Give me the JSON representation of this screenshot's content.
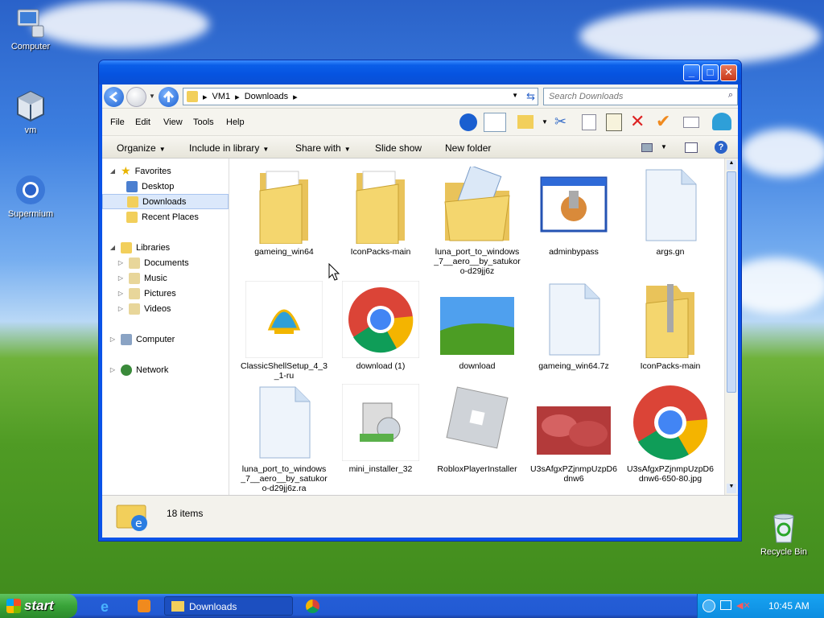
{
  "desktop": {
    "icons": [
      {
        "label": "Computer"
      },
      {
        "label": "vm"
      },
      {
        "label": "Supermium"
      },
      {
        "label": "Recycle Bin"
      }
    ]
  },
  "window": {
    "address": {
      "crumbs": [
        "VM1",
        "Downloads"
      ]
    },
    "search_placeholder": "Search Downloads",
    "menu": [
      "File",
      "Edit",
      "View",
      "Tools",
      "Help"
    ],
    "commands": {
      "organize": "Organize",
      "include": "Include in library",
      "share": "Share with",
      "slideshow": "Slide show",
      "newfolder": "New folder"
    },
    "nav": {
      "favorites": "Favorites",
      "desktop": "Desktop",
      "downloads": "Downloads",
      "recent": "Recent Places",
      "libraries": "Libraries",
      "documents": "Documents",
      "music": "Music",
      "pictures": "Pictures",
      "videos": "Videos",
      "computer": "Computer",
      "network": "Network"
    },
    "files": [
      {
        "name": "gameing_win64",
        "kind": "folder"
      },
      {
        "name": "IconPacks-main",
        "kind": "folder"
      },
      {
        "name": "luna_port_to_windows_7__aero__by_satukoro-d29jj6z",
        "kind": "folder-open"
      },
      {
        "name": "adminbypass",
        "kind": "app"
      },
      {
        "name": "args.gn",
        "kind": "doc"
      },
      {
        "name": "ClassicShellSetup_4_3_1-ru",
        "kind": "shell"
      },
      {
        "name": "download (1)",
        "kind": "chrome-img"
      },
      {
        "name": "download",
        "kind": "bliss"
      },
      {
        "name": "gameing_win64.7z",
        "kind": "doc"
      },
      {
        "name": "IconPacks-main",
        "kind": "zip"
      },
      {
        "name": "luna_port_to_windows_7__aero__by_satukoro-d29jj6z.ra",
        "kind": "doc"
      },
      {
        "name": "mini_installer_32",
        "kind": "installer"
      },
      {
        "name": "RobloxPlayerInstaller",
        "kind": "roblox"
      },
      {
        "name": "U3sAfgxPZjnmpUzpD6dnw6",
        "kind": "meat"
      },
      {
        "name": "U3sAfgxPZjnmpUzpD6dnw6-650-80.jpg",
        "kind": "chrome"
      }
    ],
    "status": "18 items"
  },
  "taskbar": {
    "start": "start",
    "task": "Downloads",
    "clock": "10:45 AM"
  }
}
